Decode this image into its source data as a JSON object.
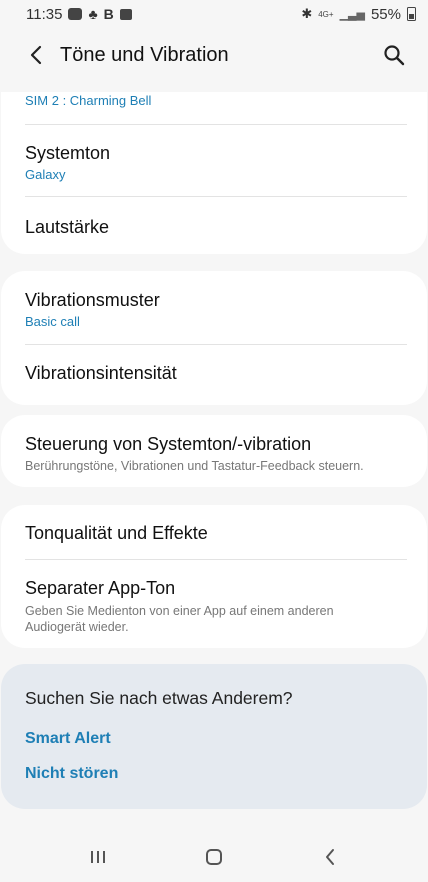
{
  "status_bar": {
    "time": "11:35",
    "left_letter": "B",
    "network": "4G+",
    "battery": "55%"
  },
  "header": {
    "title": "Töne und Vibration"
  },
  "groups": {
    "ringtone_partial": {
      "sub": "SIM 2 : Charming Bell"
    },
    "systemton": {
      "title": "Systemton",
      "sub": "Galaxy"
    },
    "lautstaerke": {
      "title": "Lautstärke"
    },
    "vibrationsmuster": {
      "title": "Vibrationsmuster",
      "sub": "Basic call"
    },
    "vibrationsintensitaet": {
      "title": "Vibrationsintensität"
    },
    "steuerung": {
      "title": "Steuerung von Systemton/-vibration",
      "sub": "Berührungstöne, Vibrationen und Tastatur-Feedback steuern."
    },
    "tonqualitaet": {
      "title": "Tonqualität und Effekte"
    },
    "separater": {
      "title": "Separater App-Ton",
      "sub_line1": "Geben Sie Medienton von einer App auf einem anderen",
      "sub_line2": "Audiogerät wieder."
    }
  },
  "suggestions": {
    "title": "Suchen Sie nach etwas Anderem?",
    "links": [
      "Smart Alert",
      "Nicht stören"
    ]
  },
  "colors": {
    "accent": "#1e7fb5",
    "background": "#f6f6f6",
    "suggest_bg": "#e5eaf0"
  }
}
